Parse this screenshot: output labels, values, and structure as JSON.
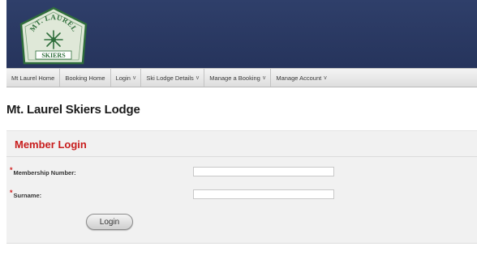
{
  "header": {
    "logo": {
      "top_text": "MT. LAUREL",
      "bottom_text": "SKIERS",
      "icon": "snowflake-icon",
      "colors": {
        "badge_fill": "#dfe8d8",
        "badge_border": "#2f6e3b",
        "text": "#2f6e3b",
        "banner": "#ffffff"
      }
    },
    "colors": {
      "background": "#2a385f"
    }
  },
  "nav": {
    "items": [
      {
        "label": "Mt Laurel Home",
        "has_caret": false
      },
      {
        "label": "Booking Home",
        "has_caret": false
      },
      {
        "label": "Login",
        "has_caret": true
      },
      {
        "label": "Ski Lodge Details",
        "has_caret": true
      },
      {
        "label": "Manage a Booking",
        "has_caret": true
      },
      {
        "label": "Manage Account",
        "has_caret": true
      }
    ],
    "caret": "v"
  },
  "page": {
    "title": "Mt. Laurel Skiers Lodge"
  },
  "login_panel": {
    "title": "Member Login",
    "title_color": "#c81d1d",
    "required_mark": "*",
    "fields": [
      {
        "label": "Membership Number:",
        "value": "",
        "required": true
      },
      {
        "label": "Surname:",
        "value": "",
        "required": true
      }
    ],
    "submit_label": "Login"
  }
}
